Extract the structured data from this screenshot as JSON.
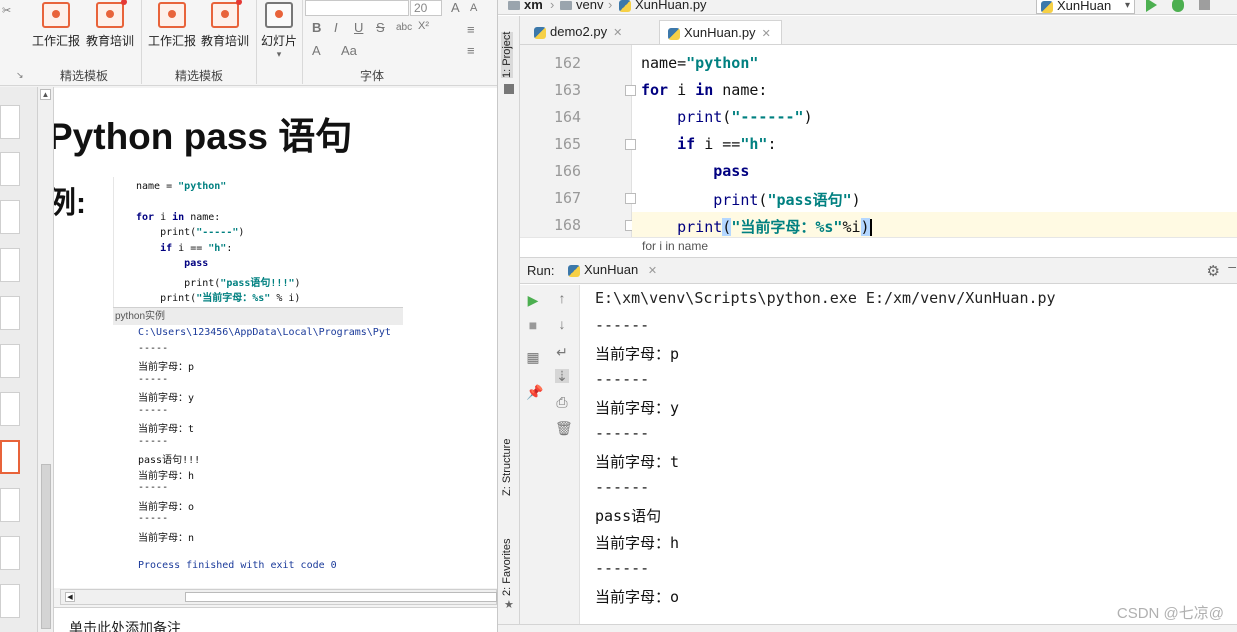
{
  "ppt": {
    "ribbon": {
      "items": [
        "工作汇报",
        "教育培训",
        "工作汇报",
        "教育培训",
        "幻灯片"
      ],
      "groups": [
        "精选模板",
        "精选模板",
        "字体"
      ],
      "font_size": "20",
      "font_buttons": [
        "B",
        "I",
        "U",
        "S",
        "abc",
        "X²",
        "A",
        "Aa"
      ]
    },
    "slide": {
      "title": "Python pass 语句",
      "subtitle": "例:",
      "code_lines": [
        "name = \"python\"",
        "",
        "for i in name:",
        "    print(\"-----\")",
        "    if i == \"h\":",
        "        pass",
        "        print(\"pass语句!!!\")",
        "    print(\"当前字母：%s\" % i)"
      ],
      "output_title": "python实例",
      "output_lines": [
        "C:\\Users\\123456\\AppData\\Local\\Programs\\Pyt",
        "-----",
        "当前字母：p",
        "-----",
        "当前字母：y",
        "-----",
        "当前字母：t",
        "-----",
        "pass语句!!!",
        "当前字母：h",
        "-----",
        "当前字母：o",
        "-----",
        "当前字母：n",
        "",
        "Process finished with exit code 0"
      ]
    },
    "notes_placeholder": "单击此处添加备注"
  },
  "ide": {
    "breadcrumbs": [
      "xm",
      "venv",
      "XunHuan.py"
    ],
    "run_config": "XunHuan",
    "left_tabs": [
      "1: Project",
      "Z: Structure",
      "2: Favorites"
    ],
    "editor_tabs": [
      {
        "label": "demo2.py",
        "active": false
      },
      {
        "label": "XunHuan.py",
        "active": true
      }
    ],
    "line_numbers": [
      "162",
      "163",
      "164",
      "165",
      "166",
      "167",
      "168"
    ],
    "code_breadcrumb": "for i in name",
    "run_panel": {
      "label": "Run:",
      "tab": "XunHuan"
    },
    "console_lines": [
      "E:\\xm\\venv\\Scripts\\python.exe E:/xm/venv/XunHuan.py",
      "------",
      "当前字母：p",
      "------",
      "当前字母：y",
      "------",
      "当前字母：t",
      "------",
      "pass语句",
      "当前字母：h",
      "------",
      "当前字母：o"
    ],
    "watermark": "CSDN @七凉@"
  }
}
